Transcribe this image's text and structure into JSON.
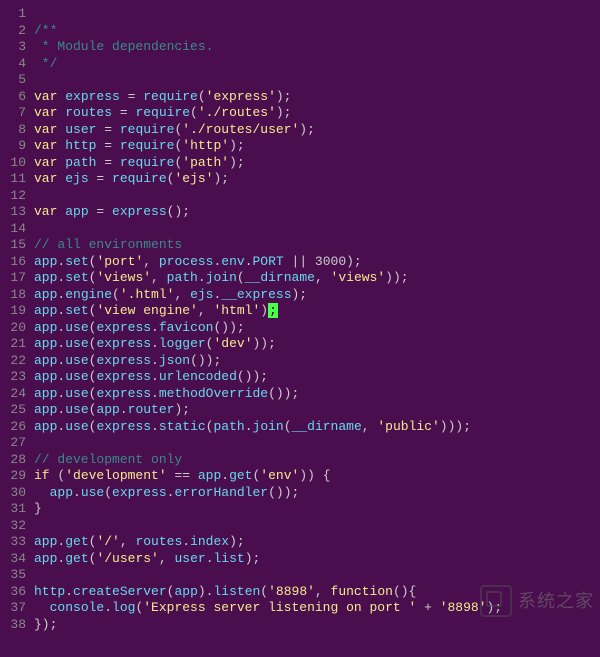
{
  "watermark_text": "系统之家",
  "lines": [
    {
      "n": 1,
      "segs": []
    },
    {
      "n": 2,
      "segs": [
        {
          "c": "tok-c",
          "t": "/**"
        }
      ]
    },
    {
      "n": 3,
      "segs": [
        {
          "c": "tok-c",
          "t": " * Module dependencies."
        }
      ]
    },
    {
      "n": 4,
      "segs": [
        {
          "c": "tok-c",
          "t": " */"
        }
      ]
    },
    {
      "n": 5,
      "segs": []
    },
    {
      "n": 6,
      "segs": [
        {
          "c": "tok-kw",
          "t": "var"
        },
        {
          "c": "tok-n",
          "t": " "
        },
        {
          "c": "tok-id",
          "t": "express"
        },
        {
          "c": "tok-n",
          "t": " = "
        },
        {
          "c": "tok-id",
          "t": "require"
        },
        {
          "c": "tok-n",
          "t": "("
        },
        {
          "c": "tok-s",
          "t": "'express'"
        },
        {
          "c": "tok-n",
          "t": ");"
        }
      ]
    },
    {
      "n": 7,
      "segs": [
        {
          "c": "tok-kw",
          "t": "var"
        },
        {
          "c": "tok-n",
          "t": " "
        },
        {
          "c": "tok-id",
          "t": "routes"
        },
        {
          "c": "tok-n",
          "t": " = "
        },
        {
          "c": "tok-id",
          "t": "require"
        },
        {
          "c": "tok-n",
          "t": "("
        },
        {
          "c": "tok-s",
          "t": "'./routes'"
        },
        {
          "c": "tok-n",
          "t": ");"
        }
      ]
    },
    {
      "n": 8,
      "segs": [
        {
          "c": "tok-kw",
          "t": "var"
        },
        {
          "c": "tok-n",
          "t": " "
        },
        {
          "c": "tok-id",
          "t": "user"
        },
        {
          "c": "tok-n",
          "t": " = "
        },
        {
          "c": "tok-id",
          "t": "require"
        },
        {
          "c": "tok-n",
          "t": "("
        },
        {
          "c": "tok-s",
          "t": "'./routes/user'"
        },
        {
          "c": "tok-n",
          "t": ");"
        }
      ]
    },
    {
      "n": 9,
      "segs": [
        {
          "c": "tok-kw",
          "t": "var"
        },
        {
          "c": "tok-n",
          "t": " "
        },
        {
          "c": "tok-id",
          "t": "http"
        },
        {
          "c": "tok-n",
          "t": " = "
        },
        {
          "c": "tok-id",
          "t": "require"
        },
        {
          "c": "tok-n",
          "t": "("
        },
        {
          "c": "tok-s",
          "t": "'http'"
        },
        {
          "c": "tok-n",
          "t": ");"
        }
      ]
    },
    {
      "n": 10,
      "segs": [
        {
          "c": "tok-kw",
          "t": "var"
        },
        {
          "c": "tok-n",
          "t": " "
        },
        {
          "c": "tok-id",
          "t": "path"
        },
        {
          "c": "tok-n",
          "t": " = "
        },
        {
          "c": "tok-id",
          "t": "require"
        },
        {
          "c": "tok-n",
          "t": "("
        },
        {
          "c": "tok-s",
          "t": "'path'"
        },
        {
          "c": "tok-n",
          "t": ");"
        }
      ]
    },
    {
      "n": 11,
      "segs": [
        {
          "c": "tok-kw",
          "t": "var"
        },
        {
          "c": "tok-n",
          "t": " "
        },
        {
          "c": "tok-id",
          "t": "ejs"
        },
        {
          "c": "tok-n",
          "t": " = "
        },
        {
          "c": "tok-id",
          "t": "require"
        },
        {
          "c": "tok-n",
          "t": "("
        },
        {
          "c": "tok-s",
          "t": "'ejs'"
        },
        {
          "c": "tok-n",
          "t": ");"
        }
      ]
    },
    {
      "n": 12,
      "segs": []
    },
    {
      "n": 13,
      "segs": [
        {
          "c": "tok-kw",
          "t": "var"
        },
        {
          "c": "tok-n",
          "t": " "
        },
        {
          "c": "tok-id",
          "t": "app"
        },
        {
          "c": "tok-n",
          "t": " = "
        },
        {
          "c": "tok-id",
          "t": "express"
        },
        {
          "c": "tok-n",
          "t": "();"
        }
      ]
    },
    {
      "n": 14,
      "segs": []
    },
    {
      "n": 15,
      "segs": [
        {
          "c": "tok-c",
          "t": "// all environments"
        }
      ]
    },
    {
      "n": 16,
      "segs": [
        {
          "c": "tok-id",
          "t": "app"
        },
        {
          "c": "tok-n",
          "t": "."
        },
        {
          "c": "tok-id",
          "t": "set"
        },
        {
          "c": "tok-n",
          "t": "("
        },
        {
          "c": "tok-s",
          "t": "'port'"
        },
        {
          "c": "tok-n",
          "t": ", "
        },
        {
          "c": "tok-id",
          "t": "process"
        },
        {
          "c": "tok-n",
          "t": "."
        },
        {
          "c": "tok-id",
          "t": "env"
        },
        {
          "c": "tok-n",
          "t": "."
        },
        {
          "c": "tok-id",
          "t": "PORT"
        },
        {
          "c": "tok-n",
          "t": " || 3000);"
        }
      ]
    },
    {
      "n": 17,
      "segs": [
        {
          "c": "tok-id",
          "t": "app"
        },
        {
          "c": "tok-n",
          "t": "."
        },
        {
          "c": "tok-id",
          "t": "set"
        },
        {
          "c": "tok-n",
          "t": "("
        },
        {
          "c": "tok-s",
          "t": "'views'"
        },
        {
          "c": "tok-n",
          "t": ", "
        },
        {
          "c": "tok-id",
          "t": "path"
        },
        {
          "c": "tok-n",
          "t": "."
        },
        {
          "c": "tok-id",
          "t": "join"
        },
        {
          "c": "tok-n",
          "t": "("
        },
        {
          "c": "tok-id",
          "t": "__dirname"
        },
        {
          "c": "tok-n",
          "t": ", "
        },
        {
          "c": "tok-s",
          "t": "'views'"
        },
        {
          "c": "tok-n",
          "t": "));"
        }
      ]
    },
    {
      "n": 18,
      "segs": [
        {
          "c": "tok-id",
          "t": "app"
        },
        {
          "c": "tok-n",
          "t": "."
        },
        {
          "c": "tok-id",
          "t": "engine"
        },
        {
          "c": "tok-n",
          "t": "("
        },
        {
          "c": "tok-s",
          "t": "'.html'"
        },
        {
          "c": "tok-n",
          "t": ", "
        },
        {
          "c": "tok-id",
          "t": "ejs"
        },
        {
          "c": "tok-n",
          "t": "."
        },
        {
          "c": "tok-id",
          "t": "__express"
        },
        {
          "c": "tok-n",
          "t": ");"
        }
      ]
    },
    {
      "n": 19,
      "segs": [
        {
          "c": "tok-id",
          "t": "app"
        },
        {
          "c": "tok-n",
          "t": "."
        },
        {
          "c": "tok-id",
          "t": "set"
        },
        {
          "c": "tok-n",
          "t": "("
        },
        {
          "c": "tok-s",
          "t": "'view engine'"
        },
        {
          "c": "tok-n",
          "t": ", "
        },
        {
          "c": "tok-s",
          "t": "'html'"
        },
        {
          "c": "tok-n",
          "t": ")"
        },
        {
          "c": "cursor",
          "t": ";"
        }
      ]
    },
    {
      "n": 20,
      "segs": [
        {
          "c": "tok-id",
          "t": "app"
        },
        {
          "c": "tok-n",
          "t": "."
        },
        {
          "c": "tok-id",
          "t": "use"
        },
        {
          "c": "tok-n",
          "t": "("
        },
        {
          "c": "tok-id",
          "t": "express"
        },
        {
          "c": "tok-n",
          "t": "."
        },
        {
          "c": "tok-id",
          "t": "favicon"
        },
        {
          "c": "tok-n",
          "t": "());"
        }
      ]
    },
    {
      "n": 21,
      "segs": [
        {
          "c": "tok-id",
          "t": "app"
        },
        {
          "c": "tok-n",
          "t": "."
        },
        {
          "c": "tok-id",
          "t": "use"
        },
        {
          "c": "tok-n",
          "t": "("
        },
        {
          "c": "tok-id",
          "t": "express"
        },
        {
          "c": "tok-n",
          "t": "."
        },
        {
          "c": "tok-id",
          "t": "logger"
        },
        {
          "c": "tok-n",
          "t": "("
        },
        {
          "c": "tok-s",
          "t": "'dev'"
        },
        {
          "c": "tok-n",
          "t": "));"
        }
      ]
    },
    {
      "n": 22,
      "segs": [
        {
          "c": "tok-id",
          "t": "app"
        },
        {
          "c": "tok-n",
          "t": "."
        },
        {
          "c": "tok-id",
          "t": "use"
        },
        {
          "c": "tok-n",
          "t": "("
        },
        {
          "c": "tok-id",
          "t": "express"
        },
        {
          "c": "tok-n",
          "t": "."
        },
        {
          "c": "tok-id",
          "t": "json"
        },
        {
          "c": "tok-n",
          "t": "());"
        }
      ]
    },
    {
      "n": 23,
      "segs": [
        {
          "c": "tok-id",
          "t": "app"
        },
        {
          "c": "tok-n",
          "t": "."
        },
        {
          "c": "tok-id",
          "t": "use"
        },
        {
          "c": "tok-n",
          "t": "("
        },
        {
          "c": "tok-id",
          "t": "express"
        },
        {
          "c": "tok-n",
          "t": "."
        },
        {
          "c": "tok-id",
          "t": "urlencoded"
        },
        {
          "c": "tok-n",
          "t": "());"
        }
      ]
    },
    {
      "n": 24,
      "segs": [
        {
          "c": "tok-id",
          "t": "app"
        },
        {
          "c": "tok-n",
          "t": "."
        },
        {
          "c": "tok-id",
          "t": "use"
        },
        {
          "c": "tok-n",
          "t": "("
        },
        {
          "c": "tok-id",
          "t": "express"
        },
        {
          "c": "tok-n",
          "t": "."
        },
        {
          "c": "tok-id",
          "t": "methodOverride"
        },
        {
          "c": "tok-n",
          "t": "());"
        }
      ]
    },
    {
      "n": 25,
      "segs": [
        {
          "c": "tok-id",
          "t": "app"
        },
        {
          "c": "tok-n",
          "t": "."
        },
        {
          "c": "tok-id",
          "t": "use"
        },
        {
          "c": "tok-n",
          "t": "("
        },
        {
          "c": "tok-id",
          "t": "app"
        },
        {
          "c": "tok-n",
          "t": "."
        },
        {
          "c": "tok-id",
          "t": "router"
        },
        {
          "c": "tok-n",
          "t": ");"
        }
      ]
    },
    {
      "n": 26,
      "segs": [
        {
          "c": "tok-id",
          "t": "app"
        },
        {
          "c": "tok-n",
          "t": "."
        },
        {
          "c": "tok-id",
          "t": "use"
        },
        {
          "c": "tok-n",
          "t": "("
        },
        {
          "c": "tok-id",
          "t": "express"
        },
        {
          "c": "tok-n",
          "t": "."
        },
        {
          "c": "tok-id",
          "t": "static"
        },
        {
          "c": "tok-n",
          "t": "("
        },
        {
          "c": "tok-id",
          "t": "path"
        },
        {
          "c": "tok-n",
          "t": "."
        },
        {
          "c": "tok-id",
          "t": "join"
        },
        {
          "c": "tok-n",
          "t": "("
        },
        {
          "c": "tok-id",
          "t": "__dirname"
        },
        {
          "c": "tok-n",
          "t": ", "
        },
        {
          "c": "tok-s",
          "t": "'public'"
        },
        {
          "c": "tok-n",
          "t": ")));"
        }
      ]
    },
    {
      "n": 27,
      "segs": []
    },
    {
      "n": 28,
      "segs": [
        {
          "c": "tok-c",
          "t": "// development only"
        }
      ]
    },
    {
      "n": 29,
      "segs": [
        {
          "c": "tok-kw",
          "t": "if"
        },
        {
          "c": "tok-n",
          "t": " ("
        },
        {
          "c": "tok-s",
          "t": "'development'"
        },
        {
          "c": "tok-n",
          "t": " == "
        },
        {
          "c": "tok-id",
          "t": "app"
        },
        {
          "c": "tok-n",
          "t": "."
        },
        {
          "c": "tok-id",
          "t": "get"
        },
        {
          "c": "tok-n",
          "t": "("
        },
        {
          "c": "tok-s",
          "t": "'env'"
        },
        {
          "c": "tok-n",
          "t": ")) {"
        }
      ]
    },
    {
      "n": 30,
      "segs": [
        {
          "c": "tok-n",
          "t": "  "
        },
        {
          "c": "tok-id",
          "t": "app"
        },
        {
          "c": "tok-n",
          "t": "."
        },
        {
          "c": "tok-id",
          "t": "use"
        },
        {
          "c": "tok-n",
          "t": "("
        },
        {
          "c": "tok-id",
          "t": "express"
        },
        {
          "c": "tok-n",
          "t": "."
        },
        {
          "c": "tok-id",
          "t": "errorHandler"
        },
        {
          "c": "tok-n",
          "t": "());"
        }
      ]
    },
    {
      "n": 31,
      "segs": [
        {
          "c": "tok-n",
          "t": "}"
        }
      ]
    },
    {
      "n": 32,
      "segs": []
    },
    {
      "n": 33,
      "segs": [
        {
          "c": "tok-id",
          "t": "app"
        },
        {
          "c": "tok-n",
          "t": "."
        },
        {
          "c": "tok-id",
          "t": "get"
        },
        {
          "c": "tok-n",
          "t": "("
        },
        {
          "c": "tok-s",
          "t": "'/'"
        },
        {
          "c": "tok-n",
          "t": ", "
        },
        {
          "c": "tok-id",
          "t": "routes"
        },
        {
          "c": "tok-n",
          "t": "."
        },
        {
          "c": "tok-id",
          "t": "index"
        },
        {
          "c": "tok-n",
          "t": ");"
        }
      ]
    },
    {
      "n": 34,
      "segs": [
        {
          "c": "tok-id",
          "t": "app"
        },
        {
          "c": "tok-n",
          "t": "."
        },
        {
          "c": "tok-id",
          "t": "get"
        },
        {
          "c": "tok-n",
          "t": "("
        },
        {
          "c": "tok-s",
          "t": "'/users'"
        },
        {
          "c": "tok-n",
          "t": ", "
        },
        {
          "c": "tok-id",
          "t": "user"
        },
        {
          "c": "tok-n",
          "t": "."
        },
        {
          "c": "tok-id",
          "t": "list"
        },
        {
          "c": "tok-n",
          "t": ");"
        }
      ]
    },
    {
      "n": 35,
      "segs": []
    },
    {
      "n": 36,
      "segs": [
        {
          "c": "tok-id",
          "t": "http"
        },
        {
          "c": "tok-n",
          "t": "."
        },
        {
          "c": "tok-id",
          "t": "createServer"
        },
        {
          "c": "tok-n",
          "t": "("
        },
        {
          "c": "tok-id",
          "t": "app"
        },
        {
          "c": "tok-n",
          "t": ")."
        },
        {
          "c": "tok-id",
          "t": "listen"
        },
        {
          "c": "tok-n",
          "t": "("
        },
        {
          "c": "tok-s",
          "t": "'8898'"
        },
        {
          "c": "tok-n",
          "t": ", "
        },
        {
          "c": "tok-kw",
          "t": "function"
        },
        {
          "c": "tok-n",
          "t": "(){"
        }
      ]
    },
    {
      "n": 37,
      "segs": [
        {
          "c": "tok-n",
          "t": "  "
        },
        {
          "c": "tok-id",
          "t": "console"
        },
        {
          "c": "tok-n",
          "t": "."
        },
        {
          "c": "tok-id",
          "t": "log"
        },
        {
          "c": "tok-n",
          "t": "("
        },
        {
          "c": "tok-s",
          "t": "'Express server listening on port '"
        },
        {
          "c": "tok-n",
          "t": " + "
        },
        {
          "c": "tok-s",
          "t": "'8898'"
        },
        {
          "c": "tok-n",
          "t": ");"
        }
      ]
    },
    {
      "n": 38,
      "segs": [
        {
          "c": "tok-n",
          "t": "});"
        }
      ]
    }
  ]
}
